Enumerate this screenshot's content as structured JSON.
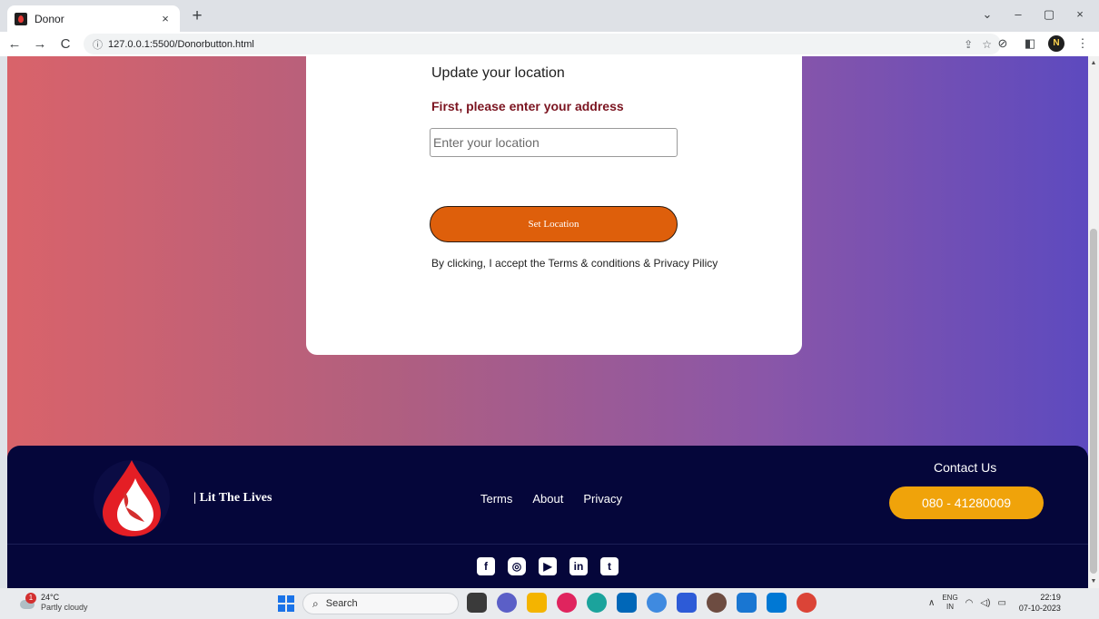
{
  "browser": {
    "tab_title": "Donor",
    "tab_close": "×",
    "new_tab": "+",
    "url": "127.0.0.1:5500/Donorbutton.html",
    "back": "←",
    "forward": "→",
    "reload": "C",
    "info": "ⓘ",
    "profile_initial": "N",
    "win_dropdown": "⌄",
    "win_minimize": "–",
    "win_restore": "▢",
    "win_close": "×"
  },
  "card": {
    "title": "Update your location",
    "subtitle": "First, please enter your address",
    "input_placeholder": "Enter your location",
    "button_label": "Set Location",
    "accept_text": "By clicking, I accept the Terms & conditions & Privacy Pilicy"
  },
  "footer": {
    "brand": "| Lit The Lives",
    "links": [
      "Terms",
      "About",
      "Privacy"
    ],
    "contact_label": "Contact Us",
    "phone": "080 - 41280009",
    "socials": [
      "facebook-icon",
      "instagram-icon",
      "youtube-icon",
      "linkedin-icon",
      "twitter-icon"
    ]
  },
  "taskbar": {
    "weather_temp": "24°C",
    "weather_condition": "Partly cloudy",
    "weather_badge": "1",
    "search_label": "Search",
    "lang_top": "ENG",
    "lang_bottom": "IN",
    "time": "22:19",
    "date": "07-10-2023"
  },
  "colors": {
    "button": "#de5f0b",
    "phone_button": "#f0a30a",
    "footer_bg": "#05063a",
    "subtitle": "#7b1420"
  }
}
